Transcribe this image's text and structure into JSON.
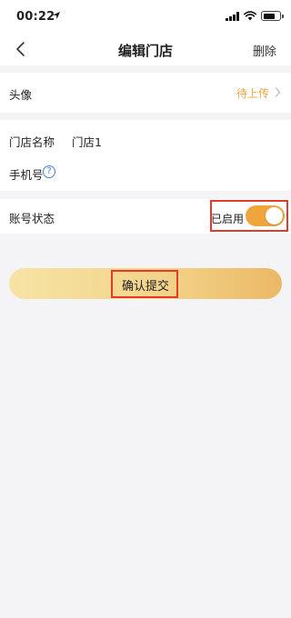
{
  "status_bar": {
    "time": "00:22"
  },
  "nav": {
    "title": "编辑门店",
    "action": "删除"
  },
  "avatar": {
    "label": "头像",
    "value": "待上传"
  },
  "store": {
    "name_label": "门店名称",
    "name_value": "门店1",
    "phone_label": "手机号",
    "phone_value": "",
    "help_glyph": "?"
  },
  "account": {
    "label": "账号状态",
    "toggle_text": "已启用",
    "enabled": true
  },
  "submit": {
    "label": "确认提交"
  },
  "colors": {
    "accent": "#f0a53c",
    "pending_text": "#e7a741",
    "help_blue": "#4b7bd8",
    "highlight_red": "#e23b2a",
    "button_gradient": [
      "#f6e3a4",
      "#ebb865"
    ]
  },
  "icons": [
    "location-arrow-icon",
    "signal-icon",
    "wifi-icon",
    "battery-icon",
    "back-arrow-icon",
    "chevron-right-icon",
    "question-icon"
  ]
}
